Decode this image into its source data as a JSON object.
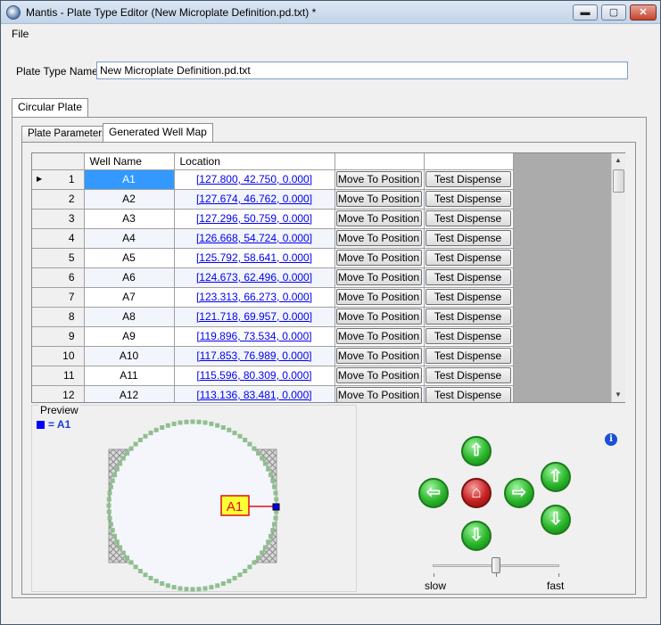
{
  "window": {
    "title": "Mantis - Plate Type Editor (New Microplate Definition.pd.txt) *",
    "minimize": "▬",
    "maximize": "▢",
    "close": "✕"
  },
  "menu": {
    "file": "File"
  },
  "plate_type_name": {
    "label": "Plate Type Name",
    "value": "New Microplate Definition.pd.txt"
  },
  "outer_tabs": [
    {
      "label": "Circular Plate",
      "active": true
    }
  ],
  "inner_tabs": [
    {
      "label": "Plate Parameters",
      "active": false
    },
    {
      "label": "Generated Well Map",
      "active": true
    }
  ],
  "grid": {
    "columns": [
      "Well Name",
      "Location"
    ],
    "button_move": "Move To Position",
    "button_test": "Test Dispense",
    "rows": [
      {
        "num": "1",
        "name": "A1",
        "loc": "[127.800, 42.750, 0.000]"
      },
      {
        "num": "2",
        "name": "A2",
        "loc": "[127.674, 46.762, 0.000]"
      },
      {
        "num": "3",
        "name": "A3",
        "loc": "[127.296, 50.759, 0.000]"
      },
      {
        "num": "4",
        "name": "A4",
        "loc": "[126.668, 54.724, 0.000]"
      },
      {
        "num": "5",
        "name": "A5",
        "loc": "[125.792, 58.641, 0.000]"
      },
      {
        "num": "6",
        "name": "A6",
        "loc": "[124.673, 62.496, 0.000]"
      },
      {
        "num": "7",
        "name": "A7",
        "loc": "[123.313, 66.273, 0.000]"
      },
      {
        "num": "8",
        "name": "A8",
        "loc": "[121.718, 69.957, 0.000]"
      },
      {
        "num": "9",
        "name": "A9",
        "loc": "[119.896, 73.534, 0.000]"
      },
      {
        "num": "10",
        "name": "A10",
        "loc": "[117.853, 76.989, 0.000]"
      },
      {
        "num": "11",
        "name": "A11",
        "loc": "[115.596, 80.309, 0.000]"
      },
      {
        "num": "12",
        "name": "A12",
        "loc": "[113.136, 83.481, 0.000]"
      }
    ]
  },
  "preview": {
    "label": "Preview",
    "legend": "= A1",
    "marker_label": "A1",
    "well_count": 84
  },
  "motion": {
    "slow": "slow",
    "fast": "fast",
    "speed_fraction": 0.5,
    "info": "i"
  },
  "colors": {
    "selection": "#3399ff",
    "well": "#8fbf8f",
    "accent_red": "#c72020",
    "accent_green": "#2bb52b"
  }
}
